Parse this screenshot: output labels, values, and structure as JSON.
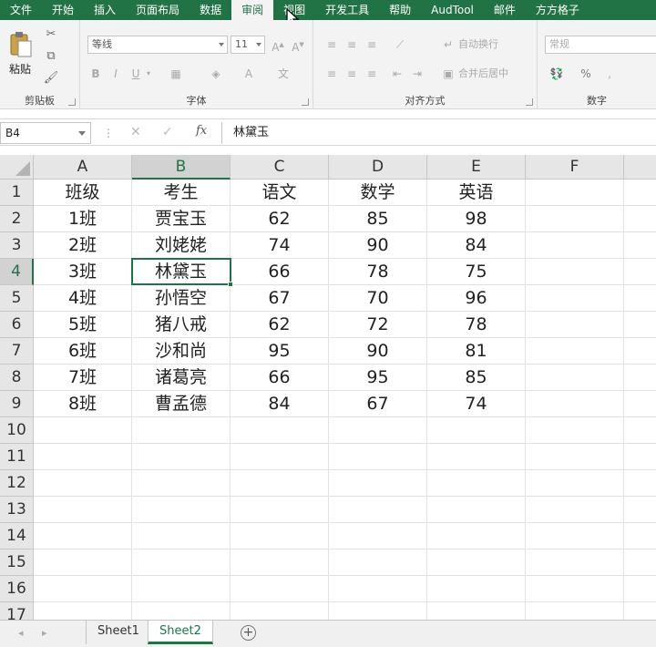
{
  "menu": {
    "tabs": [
      "文件",
      "开始",
      "插入",
      "页面布局",
      "数据",
      "审阅",
      "视图",
      "开发工具",
      "帮助",
      "AudTool",
      "邮件",
      "方方格子"
    ],
    "active_index": 5
  },
  "ribbon": {
    "clipboard": {
      "label": "剪贴板",
      "paste_label": "粘贴"
    },
    "font": {
      "label": "字体",
      "font_name": "等线",
      "font_size": "11",
      "bold": "B",
      "italic": "I",
      "underline": "U"
    },
    "alignment": {
      "label": "对齐方式",
      "wrap_text": "自动换行",
      "merge_center": "合并后居中"
    },
    "number": {
      "label": "数字",
      "format": "常规",
      "percent": "%"
    }
  },
  "formula_bar": {
    "name_box": "B4",
    "fx": "fx",
    "content": "林黛玉"
  },
  "grid": {
    "columns": [
      "A",
      "B",
      "C",
      "D",
      "E",
      "F"
    ],
    "selected_column": "B",
    "row_numbers": [
      "1",
      "2",
      "3",
      "4",
      "5",
      "6",
      "7",
      "8",
      "9",
      "10",
      "11",
      "12",
      "13",
      "14",
      "15",
      "16",
      "17"
    ],
    "selected_row": "4",
    "rows": [
      [
        "班级",
        "考生",
        "语文",
        "数学",
        "英语",
        ""
      ],
      [
        "1班",
        "贾宝玉",
        "62",
        "85",
        "98",
        ""
      ],
      [
        "2班",
        "刘姥姥",
        "74",
        "90",
        "84",
        ""
      ],
      [
        "3班",
        "林黛玉",
        "66",
        "78",
        "75",
        ""
      ],
      [
        "4班",
        "孙悟空",
        "67",
        "70",
        "96",
        ""
      ],
      [
        "5班",
        "猪八戒",
        "62",
        "72",
        "78",
        ""
      ],
      [
        "6班",
        "沙和尚",
        "95",
        "90",
        "81",
        ""
      ],
      [
        "7班",
        "诸葛亮",
        "66",
        "95",
        "85",
        ""
      ],
      [
        "8班",
        "曹孟德",
        "84",
        "67",
        "74",
        ""
      ]
    ]
  },
  "sheets": {
    "tabs": [
      "Sheet1",
      "Sheet2"
    ],
    "active": "Sheet2",
    "add_label": "+"
  }
}
